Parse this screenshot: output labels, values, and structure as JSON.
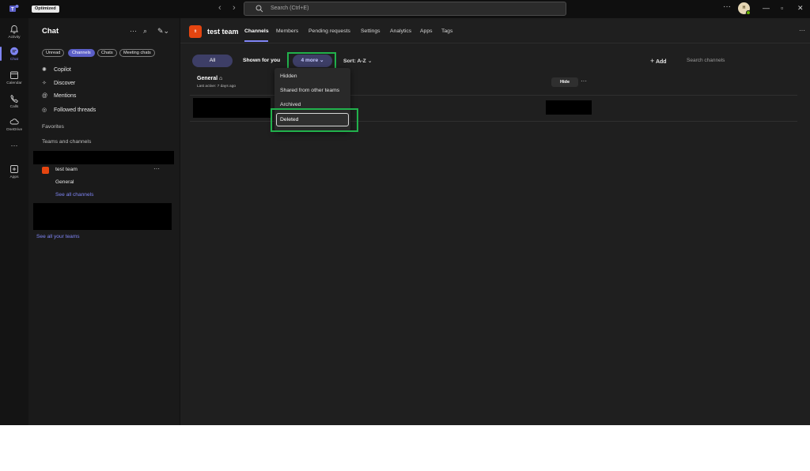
{
  "titlebar": {
    "badge": "Optimized",
    "search_placeholder": "Search (Ctrl+E)",
    "avatar_initials": "H"
  },
  "rail": {
    "items": [
      {
        "label": "Activity",
        "icon": "bell-icon"
      },
      {
        "label": "Chat",
        "icon": "chat-icon"
      },
      {
        "label": "Calendar",
        "icon": "calendar-icon"
      },
      {
        "label": "Calls",
        "icon": "phone-icon"
      },
      {
        "label": "OneDrive",
        "icon": "cloud-icon"
      },
      {
        "label": "Apps",
        "icon": "apps-add-icon"
      }
    ],
    "more": "···"
  },
  "sidebar": {
    "title": "Chat",
    "filters": [
      "Unread",
      "Channels",
      "Chats",
      "Meeting chats"
    ],
    "nav": [
      "Copilot",
      "Discover",
      "Mentions",
      "Followed threads"
    ],
    "favorites": "Favorites",
    "teams_channels": "Teams and channels",
    "team": {
      "name": "test team",
      "avatar": "tt",
      "channel": "General",
      "see_all": "See all channels"
    },
    "see_all_teams": "See all your teams"
  },
  "header": {
    "team_avatar": "tt",
    "team_name": "test team",
    "tabs": [
      "Channels",
      "Members",
      "Pending requests",
      "Settings",
      "Analytics",
      "Apps",
      "Tags"
    ],
    "more": "···"
  },
  "filters": {
    "all": "All",
    "shown": "Shown for you",
    "more": "4 more",
    "sort": "Sort: A-Z",
    "add": "Add",
    "search_placeholder": "Search channels"
  },
  "channel": {
    "name": "General",
    "subtitle": "Last active: 7 days ago",
    "hide": "Hide"
  },
  "dropdown": {
    "items": [
      "Hidden",
      "Shared from other teams",
      "Archived",
      "Deleted"
    ]
  },
  "colors": {
    "accent": "#5b5fc7",
    "highlight_box": "#21b14c",
    "team_avatar": "#e54510"
  }
}
